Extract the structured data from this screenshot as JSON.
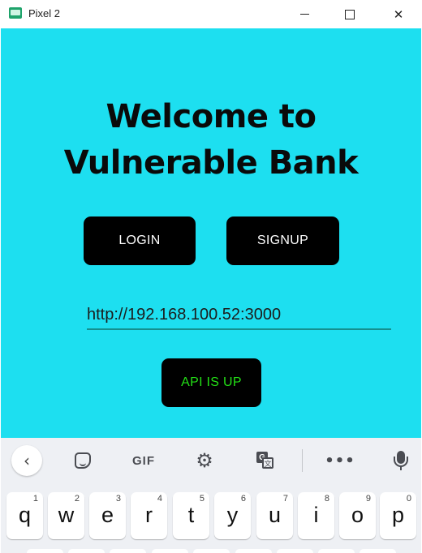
{
  "window": {
    "title": "Pixel 2",
    "minimize_glyph": "",
    "maximize_glyph": "",
    "close_glyph": "✕"
  },
  "app": {
    "background_color": "#1ddff0",
    "welcome_line1": "Welcome to",
    "welcome_line2": "Vulnerable Bank",
    "login_label": "LOGIN",
    "signup_label": "SIGNUP",
    "api_url_value": "http://192.168.100.52:3000",
    "api_status_label": "API IS UP",
    "api_status_color": "#23e016"
  },
  "keyboard": {
    "toolbar": {
      "back_glyph": "‹",
      "gif_label": "GIF",
      "settings_glyph": "⚙",
      "translate_primary": "G",
      "translate_secondary": "文",
      "more_glyph": "•••",
      "icons": [
        "back-icon",
        "sticker-icon",
        "gif-icon",
        "settings-icon",
        "translate-icon",
        "more-icon",
        "microphone-icon"
      ]
    },
    "top_row": [
      {
        "char": "q",
        "num": "1"
      },
      {
        "char": "w",
        "num": "2"
      },
      {
        "char": "e",
        "num": "3"
      },
      {
        "char": "r",
        "num": "4"
      },
      {
        "char": "t",
        "num": "5"
      },
      {
        "char": "y",
        "num": "6"
      },
      {
        "char": "u",
        "num": "7"
      },
      {
        "char": "i",
        "num": "8"
      },
      {
        "char": "o",
        "num": "9"
      },
      {
        "char": "p",
        "num": "0"
      }
    ]
  }
}
